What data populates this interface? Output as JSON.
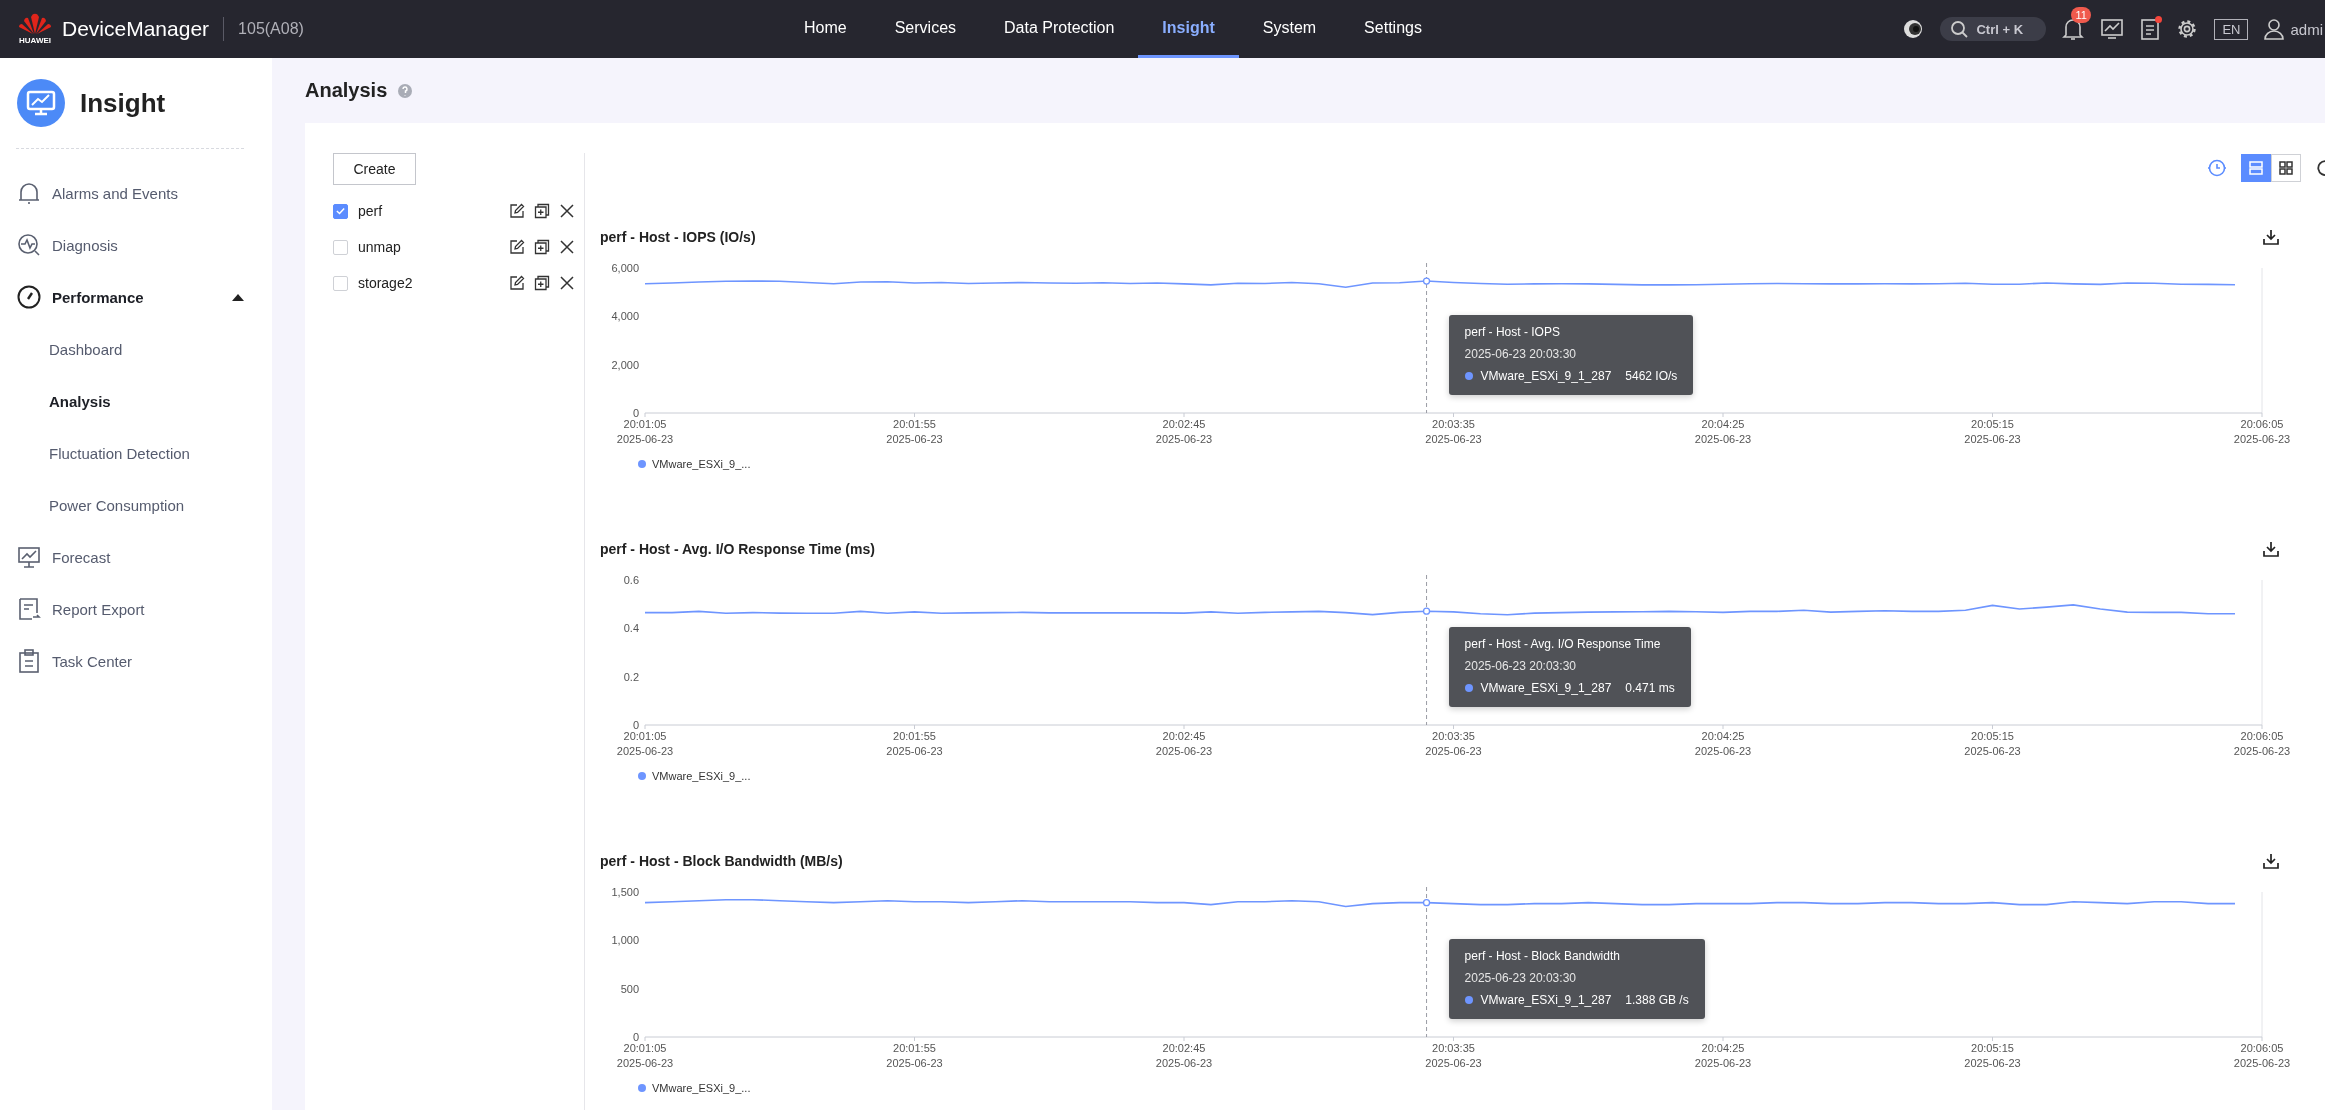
{
  "top_bar": {
    "brand": "HUAWEI",
    "app_name": "DeviceManager",
    "device": "105(A08)",
    "nav": [
      {
        "label": "Home",
        "selected": false
      },
      {
        "label": "Services",
        "selected": false
      },
      {
        "label": "Data Protection",
        "selected": false
      },
      {
        "label": "Insight",
        "selected": true
      },
      {
        "label": "System",
        "selected": false
      },
      {
        "label": "Settings",
        "selected": false
      }
    ],
    "search": {
      "shortcut": "Ctrl + K"
    },
    "notifications": {
      "badge": "11"
    },
    "messages": {
      "unread": true
    },
    "language": "EN",
    "user": "admi"
  },
  "sidebar": {
    "title": "Insight",
    "items": [
      {
        "label": "Alarms and Events",
        "selected": false
      },
      {
        "label": "Diagnosis",
        "selected": false
      },
      {
        "label": "Performance",
        "selected": false,
        "expanded": true,
        "children": [
          {
            "label": "Dashboard",
            "selected": false
          },
          {
            "label": "Analysis",
            "selected": true
          },
          {
            "label": "Fluctuation Detection",
            "selected": false
          },
          {
            "label": "Power Consumption",
            "selected": false
          }
        ]
      },
      {
        "label": "Forecast",
        "selected": false
      },
      {
        "label": "Report Export",
        "selected": false
      },
      {
        "label": "Task Center",
        "selected": false
      }
    ]
  },
  "page": {
    "title": "Analysis"
  },
  "analysis_list": {
    "create_button": "Create",
    "items": [
      {
        "label": "perf",
        "checked": true
      },
      {
        "label": "unmap",
        "checked": false
      },
      {
        "label": "storage2",
        "checked": false
      }
    ]
  },
  "view_toggle": [
    {
      "selected": true
    },
    {
      "selected": false
    }
  ],
  "charts": [
    {
      "title": "perf - Host - IOPS (IO/s)",
      "legend_label": "VMware_ESXi_9_...",
      "tooltip": {
        "title": "perf - Host - IOPS",
        "time": "2025-06-23 20:03:30",
        "value": "5462 IO/s"
      },
      "chart_data": {
        "type": "line",
        "categories": [
          "20:01:05\n2025-06-23",
          null,
          null,
          null,
          null,
          null,
          null,
          null,
          null,
          null,
          "20:01:55\n2025-06-23",
          null,
          null,
          null,
          null,
          null,
          null,
          null,
          null,
          null,
          "20:02:45\n2025-06-23",
          null,
          null,
          null,
          null,
          null,
          null,
          null,
          null,
          null,
          "20:03:35\n2025-06-23",
          null,
          null,
          null,
          null,
          null,
          null,
          null,
          null,
          null,
          "20:04:25\n2025-06-23",
          null,
          null,
          null,
          null,
          null,
          null,
          null,
          null,
          null,
          "20:05:15\n2025-06-23",
          null,
          null,
          null,
          null,
          null,
          null,
          null,
          null,
          null,
          "20:06:05\n2025-06-23"
        ],
        "series": [
          {
            "name": "VMware_ESXi_9_1_287",
            "color": "#6e95ff",
            "values": [
              5350,
              5380,
              5420,
              5450,
              5460,
              5450,
              5400,
              5350,
              5420,
              5430,
              5380,
              5400,
              5360,
              5380,
              5400,
              5380,
              5370,
              5390,
              5360,
              5380,
              5340,
              5300,
              5370,
              5360,
              5400,
              5350,
              5200,
              5380,
              5390,
              5460,
              5400,
              5360,
              5330,
              5340,
              5350,
              5340,
              5320,
              5300,
              5300,
              5310,
              5330,
              5350,
              5360,
              5350,
              5340,
              5340,
              5350,
              5340,
              5350,
              5370,
              5330,
              5330,
              5380,
              5340,
              5320,
              5380,
              5370,
              5330,
              5320,
              5310,
              null
            ]
          }
        ],
        "ylim": [
          0,
          6000
        ],
        "yticks": [
          0,
          {
            "value": 2000,
            "label": "2,000"
          },
          {
            "value": 4000,
            "label": "4,000"
          },
          {
            "value": 6000,
            "label": "6,000"
          }
        ]
      }
    },
    {
      "title": "perf - Host - Avg. I/O Response Time (ms)",
      "legend_label": "VMware_ESXi_9_...",
      "tooltip": {
        "title": "perf - Host - Avg. I/O Response Time",
        "time": "2025-06-23 20:03:30",
        "value": "0.471 ms"
      },
      "chart_data": {
        "type": "line",
        "categories": [
          "20:01:05\n2025-06-23",
          null,
          null,
          null,
          null,
          null,
          null,
          null,
          null,
          null,
          "20:01:55\n2025-06-23",
          null,
          null,
          null,
          null,
          null,
          null,
          null,
          null,
          null,
          "20:02:45\n2025-06-23",
          null,
          null,
          null,
          null,
          null,
          null,
          null,
          null,
          null,
          "20:03:35\n2025-06-23",
          null,
          null,
          null,
          null,
          null,
          null,
          null,
          null,
          null,
          "20:04:25\n2025-06-23",
          null,
          null,
          null,
          null,
          null,
          null,
          null,
          null,
          null,
          "20:05:15\n2025-06-23",
          null,
          null,
          null,
          null,
          null,
          null,
          null,
          null,
          null,
          "20:06:05\n2025-06-23"
        ],
        "series": [
          {
            "name": "VMware_ESXi_9_1_287",
            "color": "#6e95ff",
            "values": [
              0.465,
              0.465,
              0.47,
              0.462,
              0.465,
              0.463,
              0.462,
              0.462,
              0.47,
              0.462,
              0.468,
              0.462,
              0.464,
              0.465,
              0.466,
              0.464,
              0.464,
              0.464,
              0.464,
              0.464,
              0.463,
              0.468,
              0.462,
              0.466,
              0.468,
              0.47,
              0.465,
              0.457,
              0.466,
              0.471,
              0.468,
              0.46,
              0.456,
              0.463,
              0.465,
              0.467,
              0.468,
              0.469,
              0.47,
              0.469,
              0.466,
              0.47,
              0.47,
              0.475,
              0.467,
              0.47,
              0.473,
              0.47,
              0.47,
              0.475,
              0.495,
              0.48,
              0.488,
              0.497,
              0.48,
              0.467,
              0.466,
              0.466,
              0.46,
              0.46,
              null
            ]
          }
        ],
        "ylim": [
          0,
          0.6
        ],
        "yticks": [
          0,
          0.2,
          0.4,
          0.6
        ]
      }
    },
    {
      "title": "perf - Host - Block Bandwidth (MB/s)",
      "legend_label": "VMware_ESXi_9_...",
      "tooltip": {
        "title": "perf - Host - Block Bandwidth",
        "time": "2025-06-23 20:03:30",
        "value": "1.388 GB /s"
      },
      "chart_data": {
        "type": "line",
        "categories": [
          "20:01:05\n2025-06-23",
          null,
          null,
          null,
          null,
          null,
          null,
          null,
          null,
          null,
          "20:01:55\n2025-06-23",
          null,
          null,
          null,
          null,
          null,
          null,
          null,
          null,
          null,
          "20:02:45\n2025-06-23",
          null,
          null,
          null,
          null,
          null,
          null,
          null,
          null,
          null,
          "20:03:35\n2025-06-23",
          null,
          null,
          null,
          null,
          null,
          null,
          null,
          null,
          null,
          "20:04:25\n2025-06-23",
          null,
          null,
          null,
          null,
          null,
          null,
          null,
          null,
          null,
          "20:05:15\n2025-06-23",
          null,
          null,
          null,
          null,
          null,
          null,
          null,
          null,
          null,
          "20:06:05\n2025-06-23"
        ],
        "series": [
          {
            "name": "VMware_ESXi_9_1_287",
            "color": "#6e95ff",
            "values": [
              1390,
              1400,
              1410,
              1420,
              1420,
              1410,
              1400,
              1390,
              1400,
              1410,
              1400,
              1400,
              1390,
              1400,
              1410,
              1400,
              1400,
              1400,
              1400,
              1390,
              1390,
              1370,
              1400,
              1400,
              1410,
              1400,
              1350,
              1380,
              1390,
              1390,
              1380,
              1370,
              1370,
              1380,
              1380,
              1390,
              1380,
              1370,
              1370,
              1380,
              1380,
              1380,
              1390,
              1390,
              1380,
              1380,
              1390,
              1390,
              1380,
              1380,
              1390,
              1370,
              1370,
              1400,
              1390,
              1380,
              1400,
              1400,
              1380,
              1380,
              null
            ]
          }
        ],
        "ylim": [
          0,
          1500
        ],
        "yticks": [
          0,
          500,
          {
            "value": 1000,
            "label": "1,000"
          },
          {
            "value": 1500,
            "label": "1,500"
          }
        ]
      }
    }
  ]
}
